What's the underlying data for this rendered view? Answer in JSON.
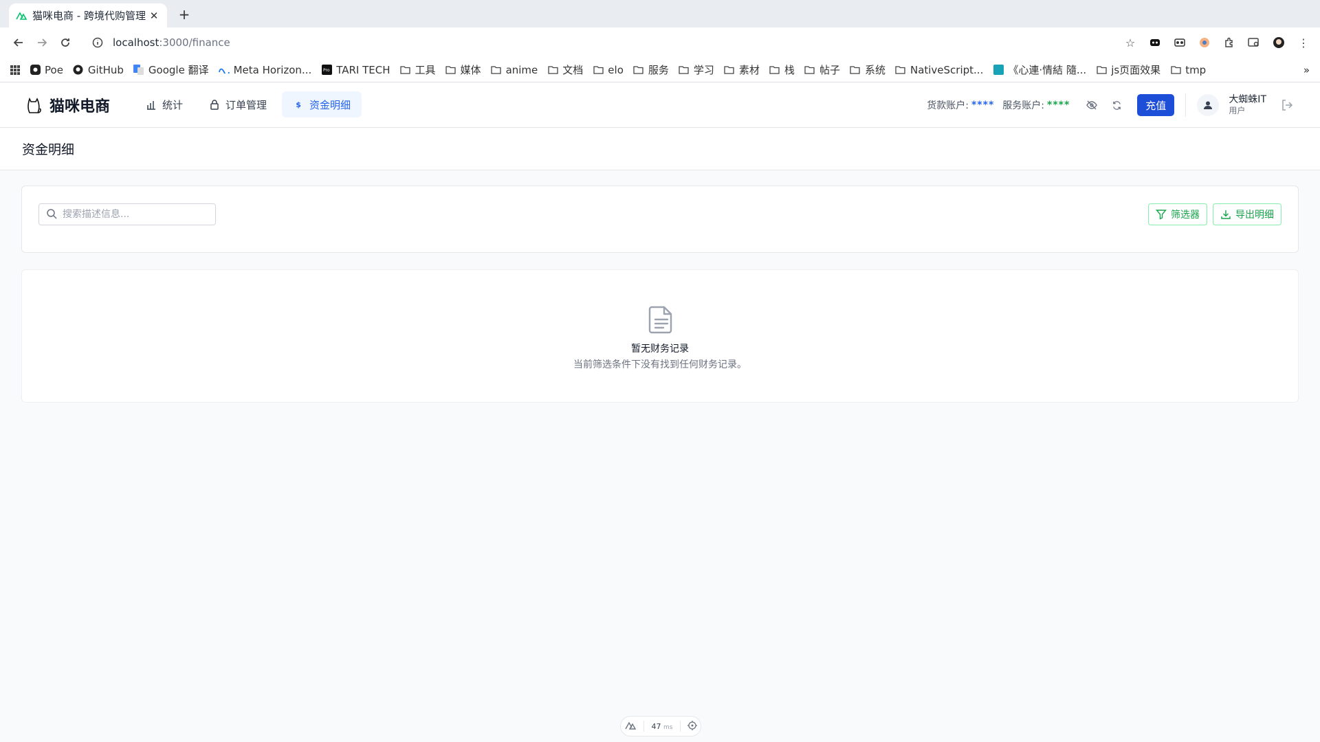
{
  "browser": {
    "tab_title": "猫咪电商 - 跨境代购管理",
    "new_tab": "+",
    "url_host": "localhost",
    "url_path": ":3000/finance",
    "bookmarks": [
      {
        "label": "Poe",
        "icon": "poe-icon"
      },
      {
        "label": "GitHub",
        "icon": "github-icon"
      },
      {
        "label": "Google 翻译",
        "icon": "google-translate-icon"
      },
      {
        "label": "Meta Horizon...",
        "icon": "meta-icon"
      },
      {
        "label": "TARI TECH",
        "icon": "pro-icon"
      },
      {
        "label": "工具",
        "icon": "folder-icon"
      },
      {
        "label": "媒体",
        "icon": "folder-icon"
      },
      {
        "label": "anime",
        "icon": "folder-icon"
      },
      {
        "label": "文档",
        "icon": "folder-icon"
      },
      {
        "label": "elo",
        "icon": "folder-icon"
      },
      {
        "label": "服务",
        "icon": "folder-icon"
      },
      {
        "label": "学习",
        "icon": "folder-icon"
      },
      {
        "label": "素材",
        "icon": "folder-icon"
      },
      {
        "label": "栈",
        "icon": "folder-icon"
      },
      {
        "label": "帖子",
        "icon": "folder-icon"
      },
      {
        "label": "系统",
        "icon": "folder-icon"
      },
      {
        "label": "NativeScript...",
        "icon": "folder-icon"
      },
      {
        "label": "《心連·情結 隨...",
        "icon": "site-icon"
      },
      {
        "label": "js页面效果",
        "icon": "folder-icon"
      },
      {
        "label": "tmp",
        "icon": "folder-icon"
      }
    ],
    "more": "»"
  },
  "app": {
    "brand": "猫咪电商",
    "nav": [
      {
        "label": "统计",
        "icon": "bar-chart-icon"
      },
      {
        "label": "订单管理",
        "icon": "lock-icon"
      },
      {
        "label": "资金明细",
        "icon": "dollar-icon"
      }
    ],
    "account_label": "货款账户:",
    "account_value": "****",
    "service_label": "服务账户:",
    "service_value": "****",
    "topup": "充值",
    "user_name": "大蜘蛛IT",
    "user_role": "用户"
  },
  "page": {
    "title": "资金明细",
    "search_placeholder": "搜索描述信息...",
    "filter_btn": "筛选器",
    "export_btn": "导出明细",
    "empty_title": "暂无财务记录",
    "empty_desc": "当前筛选条件下没有找到任何财务记录。"
  },
  "devbar": {
    "ms": "47",
    "unit": "ms"
  },
  "colors": {
    "accent": "#1d4ed8",
    "green": "#16a34a",
    "active_nav_bg": "#eff6ff"
  }
}
